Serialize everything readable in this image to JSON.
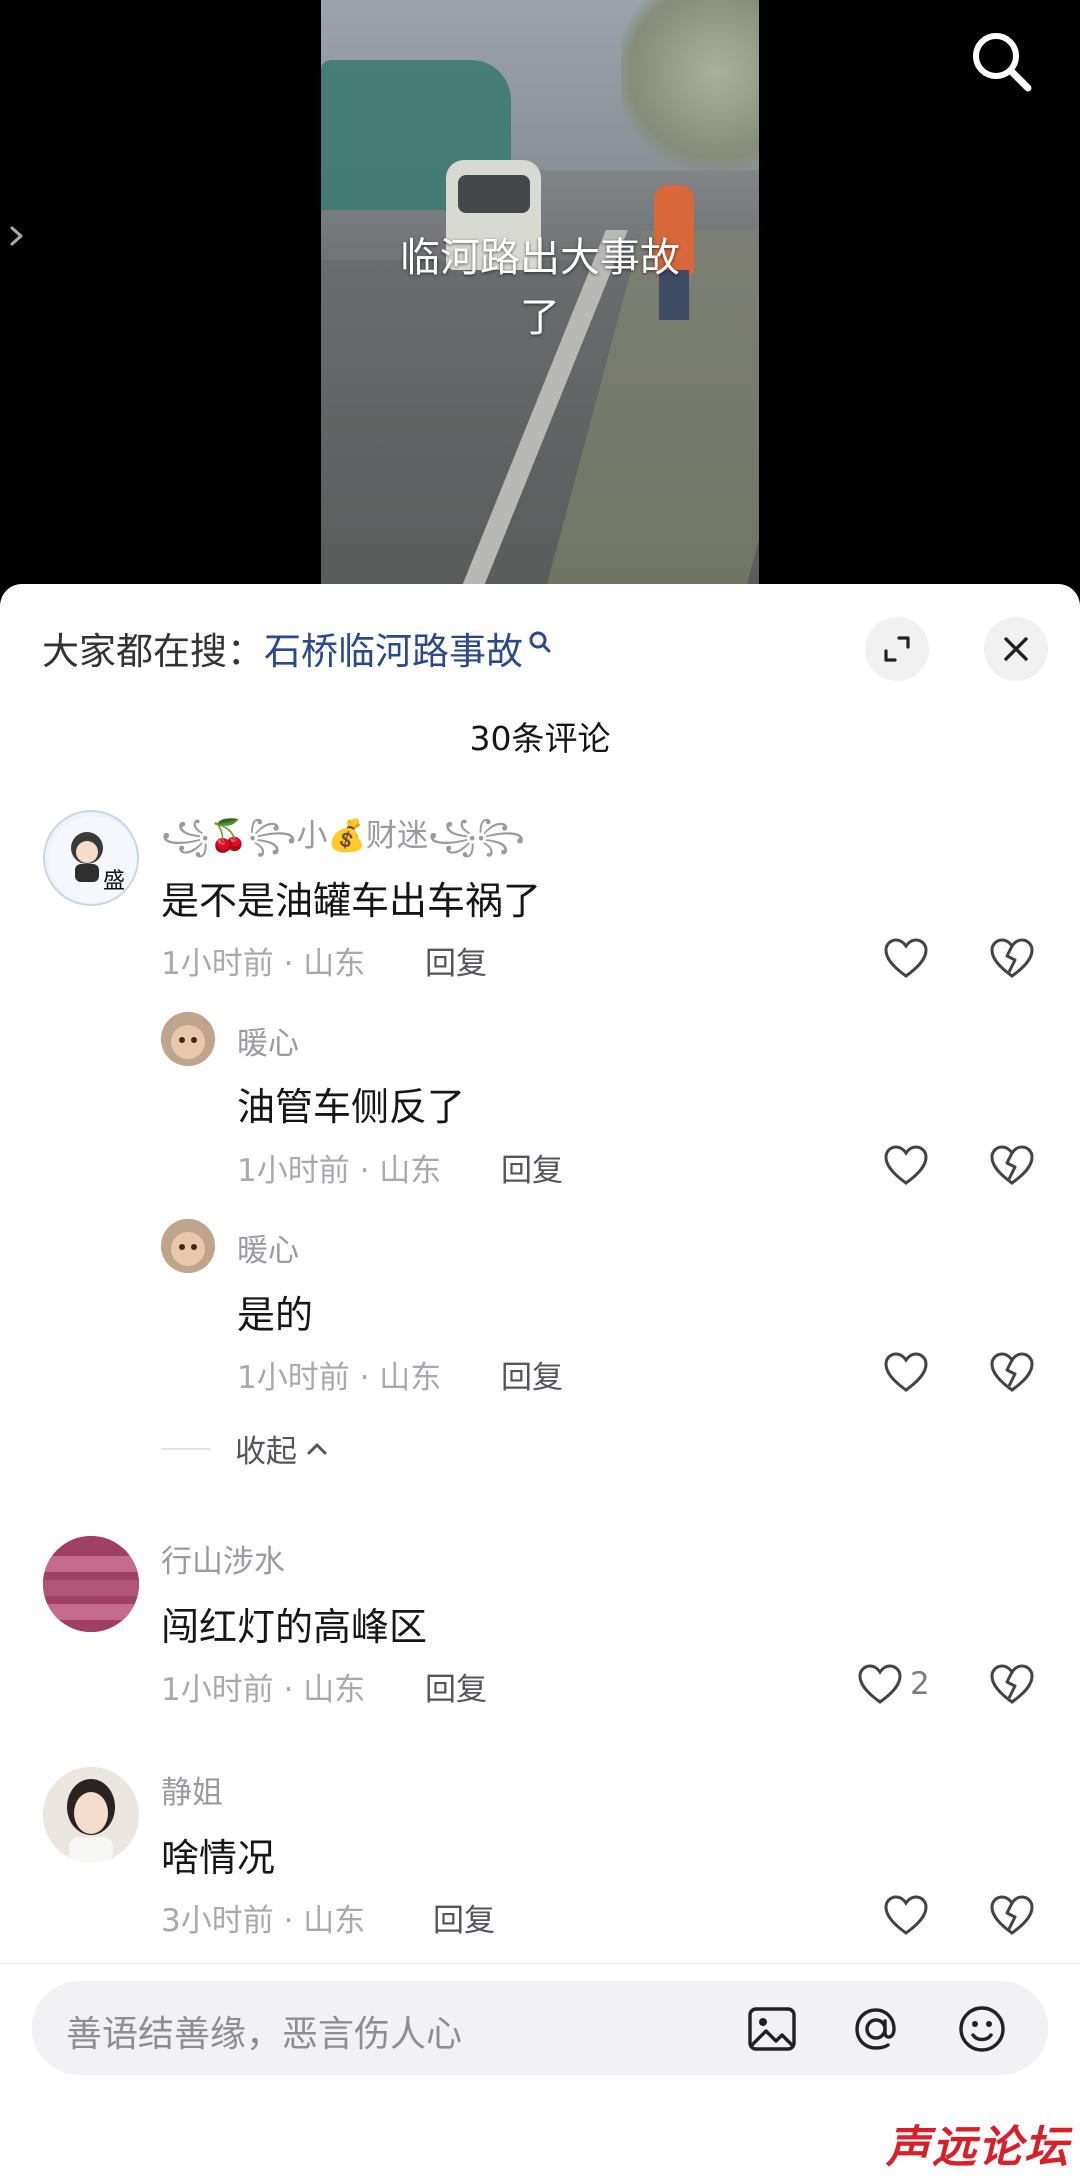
{
  "video": {
    "caption": "临河路出大事故了"
  },
  "sheet": {
    "hot_search_label": "大家都在搜：",
    "hot_search_query": "石桥临河路事故",
    "comment_count": "30条评论",
    "collapse_label": "收起"
  },
  "comments": [
    {
      "username": "꧁🍒꧂小💰财迷꧁꧂",
      "content": "是不是油罐车出车祸了",
      "meta": "1小时前 · 山东",
      "reply": "回复"
    },
    {
      "username": "暖心",
      "content": "油管车侧反了",
      "meta": "1小时前 · 山东",
      "reply": "回复"
    },
    {
      "username": "暖心",
      "content": "是的",
      "meta": "1小时前 · 山东",
      "reply": "回复"
    },
    {
      "username": "行山涉水",
      "content": "闯红灯的高峰区",
      "meta": "1小时前 · 山东",
      "reply": "回复",
      "likes": "2"
    },
    {
      "username": "静姐",
      "content": "啥情况",
      "meta": "3小时前 · 山东",
      "reply": "回复"
    }
  ],
  "input": {
    "placeholder": "善语结善缘，恶言伤人心"
  },
  "avatar_badge_text": "盛",
  "watermark": "声远论坛",
  "colors": {
    "hot_query": "#2c4a8a",
    "watermark": "#d8202a"
  },
  "icons": [
    "search-icon",
    "chevron-right-icon",
    "expand-icon",
    "close-icon",
    "heart-icon",
    "broken-heart-icon",
    "image-icon",
    "at-icon",
    "emoji-icon"
  ]
}
